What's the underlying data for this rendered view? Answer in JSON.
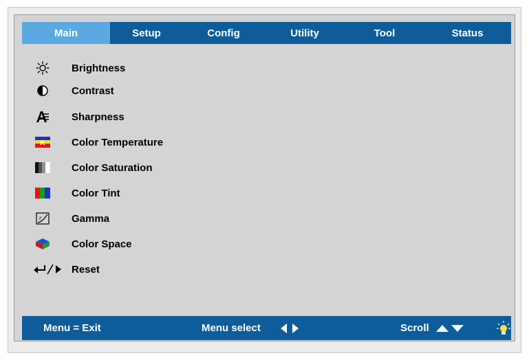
{
  "tabs": [
    {
      "label": "Main",
      "active": true
    },
    {
      "label": "Setup",
      "active": false
    },
    {
      "label": "Config",
      "active": false
    },
    {
      "label": "Utility",
      "active": false
    },
    {
      "label": "Tool",
      "active": false
    },
    {
      "label": "Status",
      "active": false
    }
  ],
  "menu": {
    "items": [
      {
        "label": "Brightness",
        "icon": "sun-icon"
      },
      {
        "label": "Contrast",
        "icon": "contrast-icon"
      },
      {
        "label": "Sharpness",
        "icon": "sharpness-icon"
      },
      {
        "label": "Color Temperature",
        "icon": "color-temperature-icon"
      },
      {
        "label": "Color Saturation",
        "icon": "color-saturation-icon"
      },
      {
        "label": "Color Tint",
        "icon": "color-tint-icon"
      },
      {
        "label": "Gamma",
        "icon": "gamma-icon"
      },
      {
        "label": "Color Space",
        "icon": "color-space-icon"
      },
      {
        "label": "Reset",
        "icon": "enter-right-icon"
      }
    ]
  },
  "footer": {
    "exit_label": "Menu = Exit",
    "select_label": "Menu select",
    "scroll_label": "Scroll"
  },
  "colors": {
    "bar": "#0e5d9a",
    "active_tab": "#5aa9e0",
    "panel": "#d4d4d4"
  }
}
